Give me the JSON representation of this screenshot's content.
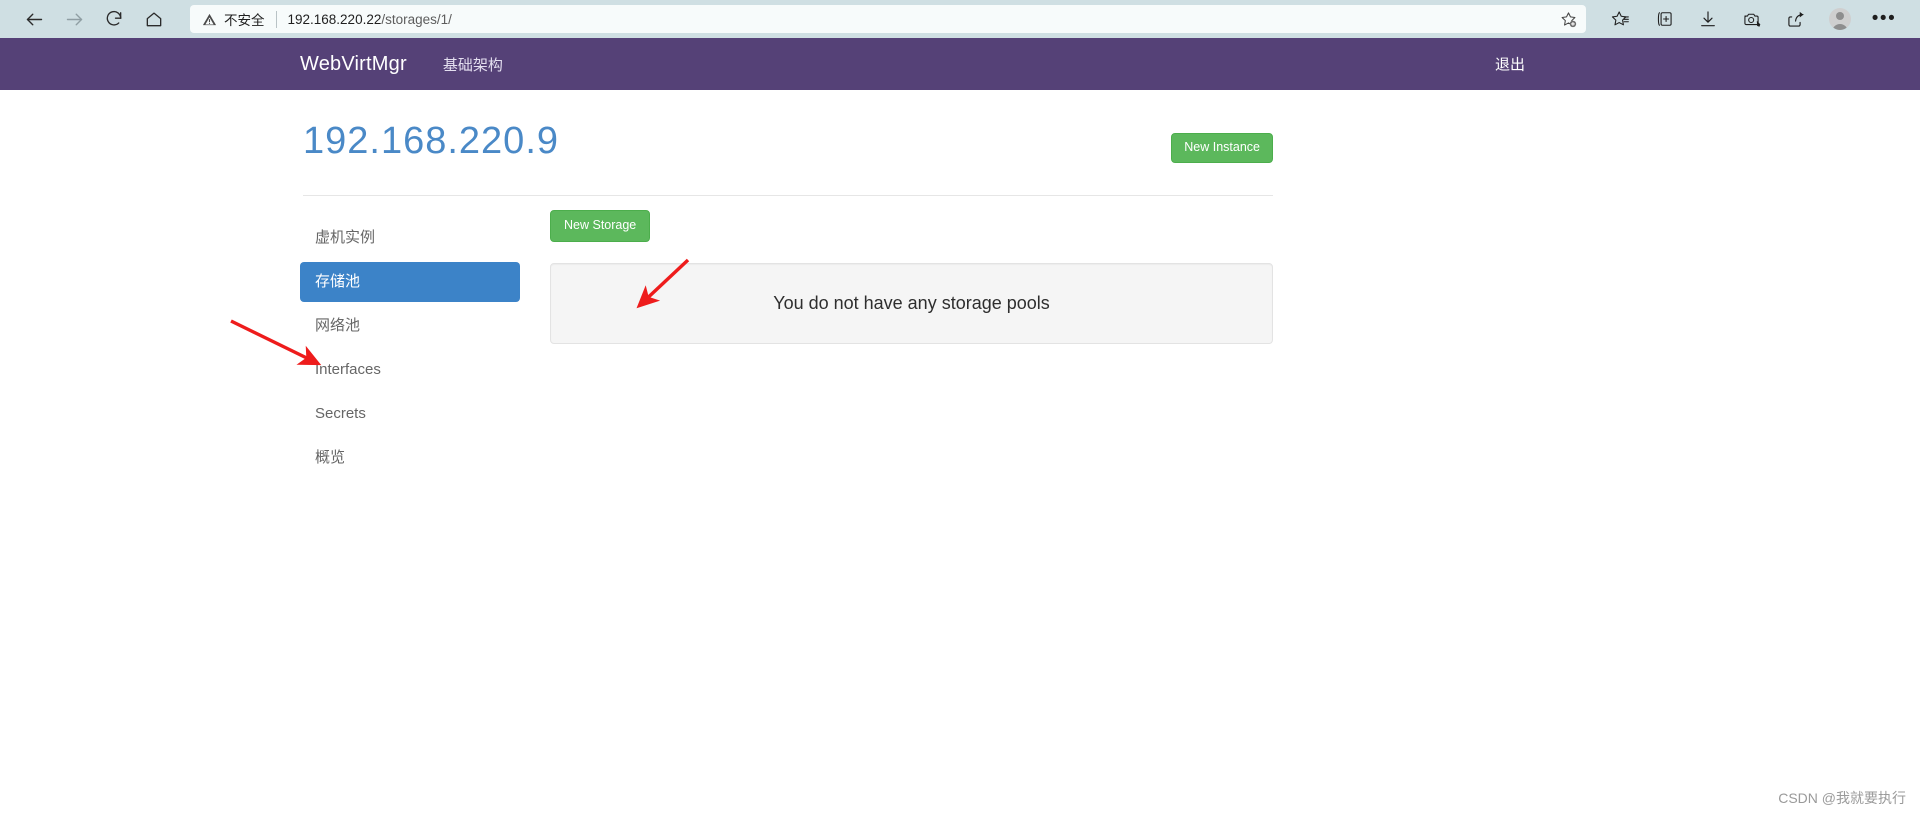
{
  "browser": {
    "nav": {
      "back": "back-arrow",
      "forward": "forward-arrow",
      "reload": "reload",
      "home": "home"
    },
    "address": {
      "security_label": "不安全",
      "url_host": "192.168.220.22",
      "url_path": "/storages/1/",
      "favorite_icon": "add-favorite-star"
    },
    "toolbar_icons": [
      "favorites-star-icon",
      "collections-icon",
      "downloads-icon",
      "web-capture-icon",
      "share-icon",
      "profile-avatar",
      "settings-more-icon"
    ]
  },
  "navbar": {
    "brand": "WebVirtMgr",
    "links": [
      {
        "label": "基础架构"
      }
    ],
    "logout": "退出",
    "background": "#554177"
  },
  "page": {
    "title": "192.168.220.9",
    "title_color": "#4a89c7",
    "new_instance_label": "New Instance",
    "accent_green": "#5cb85c",
    "accent_blue": "#3c83c8"
  },
  "sidebar": {
    "items": [
      {
        "label": "虚机实例",
        "active": false
      },
      {
        "label": "存储池",
        "active": true
      },
      {
        "label": "网络池",
        "active": false
      },
      {
        "label": "Interfaces",
        "active": false
      },
      {
        "label": "Secrets",
        "active": false
      },
      {
        "label": "概览",
        "active": false
      }
    ]
  },
  "main": {
    "new_storage_label": "New Storage",
    "empty_message": "You do not have any storage pools"
  },
  "annotations": [
    {
      "name": "arrow-to-storage-pools-sidebar",
      "color": "#ee1c1c"
    },
    {
      "name": "arrow-to-new-storage-button",
      "color": "#ee1c1c"
    }
  ],
  "watermark": "CSDN @我就要执行"
}
